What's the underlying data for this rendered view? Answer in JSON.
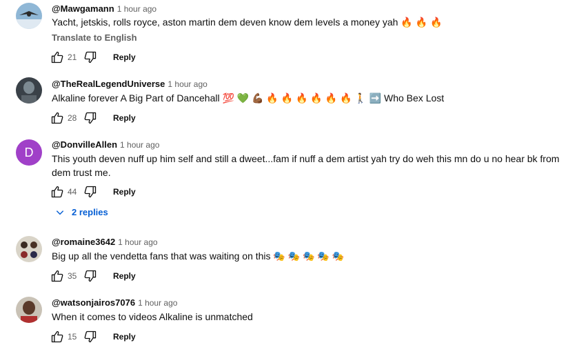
{
  "comments": [
    {
      "handle": "@Mawgamann",
      "time": "1 hour ago",
      "text": "Yacht, jetskis, rolls royce, aston martin dem deven know dem levels a money yah 🔥 🔥 🔥",
      "translate": "Translate to English",
      "likes": "21",
      "reply": "Reply"
    },
    {
      "handle": "@TheRealLegendUniverse",
      "time": "1 hour ago",
      "text": "Alkaline forever A Big Part of Dancehall 💯 💚 💪🏾 🔥 🔥 🔥 🔥 🔥 🔥 🚶 ➡️ Who Bex Lost",
      "likes": "28",
      "reply": "Reply"
    },
    {
      "handle": "@DonvilleAllen",
      "time": "1 hour ago",
      "avatar_letter": "D",
      "text": "This youth deven nuff up him self and still a dweet...fam if nuff a dem artist yah try do weh this mn do u no hear bk from dem trust me.",
      "likes": "44",
      "reply": "Reply",
      "replies_label": "2 replies"
    },
    {
      "handle": "@romaine3642",
      "time": "1 hour ago",
      "text": "Big up all the vendetta fans that was waiting on this 🎭 🎭 🎭 🎭 🎭",
      "likes": "35",
      "reply": "Reply"
    },
    {
      "handle": "@watsonjairos7076",
      "time": "1 hour ago",
      "text": "When it comes to videos Alkaline is unmatched",
      "likes": "15",
      "reply": "Reply"
    }
  ],
  "colors": {
    "link": "#065fd4",
    "meta": "#606060",
    "avatar_d": "#a040c8"
  }
}
